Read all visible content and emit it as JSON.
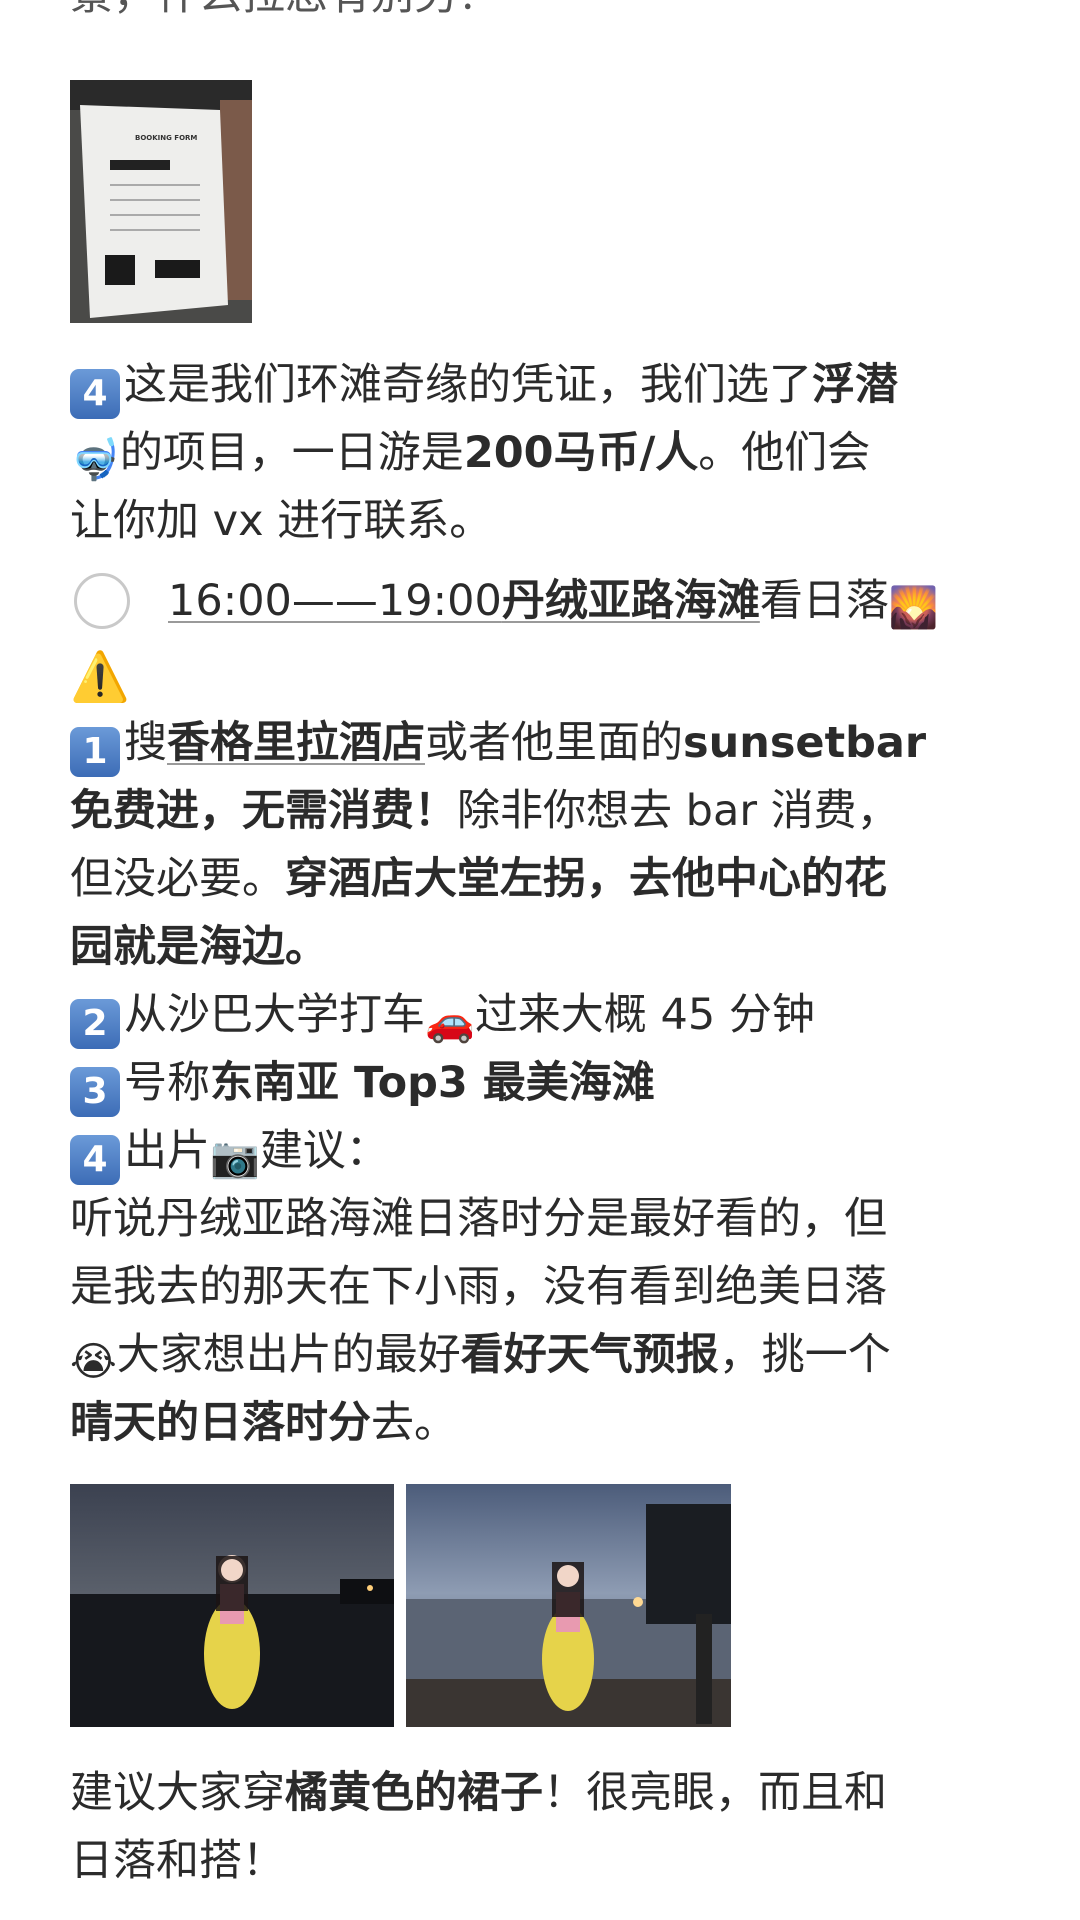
{
  "top_text_cut": "景，什么拉您有别另！",
  "item4_a": "这是我们环滩奇缘的凭证，我们选了",
  "item4_b": "浮潜",
  "item4_c": "的项目，一日游是",
  "item4_d": "200马币/人",
  "item4_e": "。他们会",
  "item4_f": "让你加 vx 进行联系。",
  "todo_time": "16:00——19:00",
  "todo_place": "丹绒亚路海滩",
  "todo_rest": "看日落",
  "s1_a": "搜",
  "s1_b": "香格里拉酒店",
  "s1_c": "或者他里面的",
  "s1_d": "sunsetbar",
  "s1_e": "免费进，无需消费！",
  "s1_f": "除非你想去 bar 消费，",
  "s1_g": "但没必要。",
  "s1_h": "穿酒店大堂左拐，去他中心的花",
  "s1_i": "园就是海边。",
  "s2_a": "从沙巴大学打车",
  "s2_b": "过来大概 45 分钟",
  "s3_a": "号称",
  "s3_b": "东南亚 Top3 最美海滩",
  "s4_a": "出片",
  "s4_b": "建议：",
  "p_1": "听说丹绒亚路海滩日落时分是最好看的，但",
  "p_2": "是我去的那天在下小雨，没有看到绝美日落",
  "p_3a": "大家想出片的最好",
  "p_3b": "看好天气预报",
  "p_3c": "，挑一个",
  "p_4a": "晴天的日落时分",
  "p_4b": "去。",
  "bottom_a": "建议大家穿",
  "bottom_b": "橘黄色的裙子",
  "bottom_c": "！很亮眼，而且和",
  "bottom_d": "日落和搭！",
  "receipt_title": "BOOKING FORM",
  "keycaps": [
    "4",
    "1",
    "2",
    "3",
    "4"
  ]
}
